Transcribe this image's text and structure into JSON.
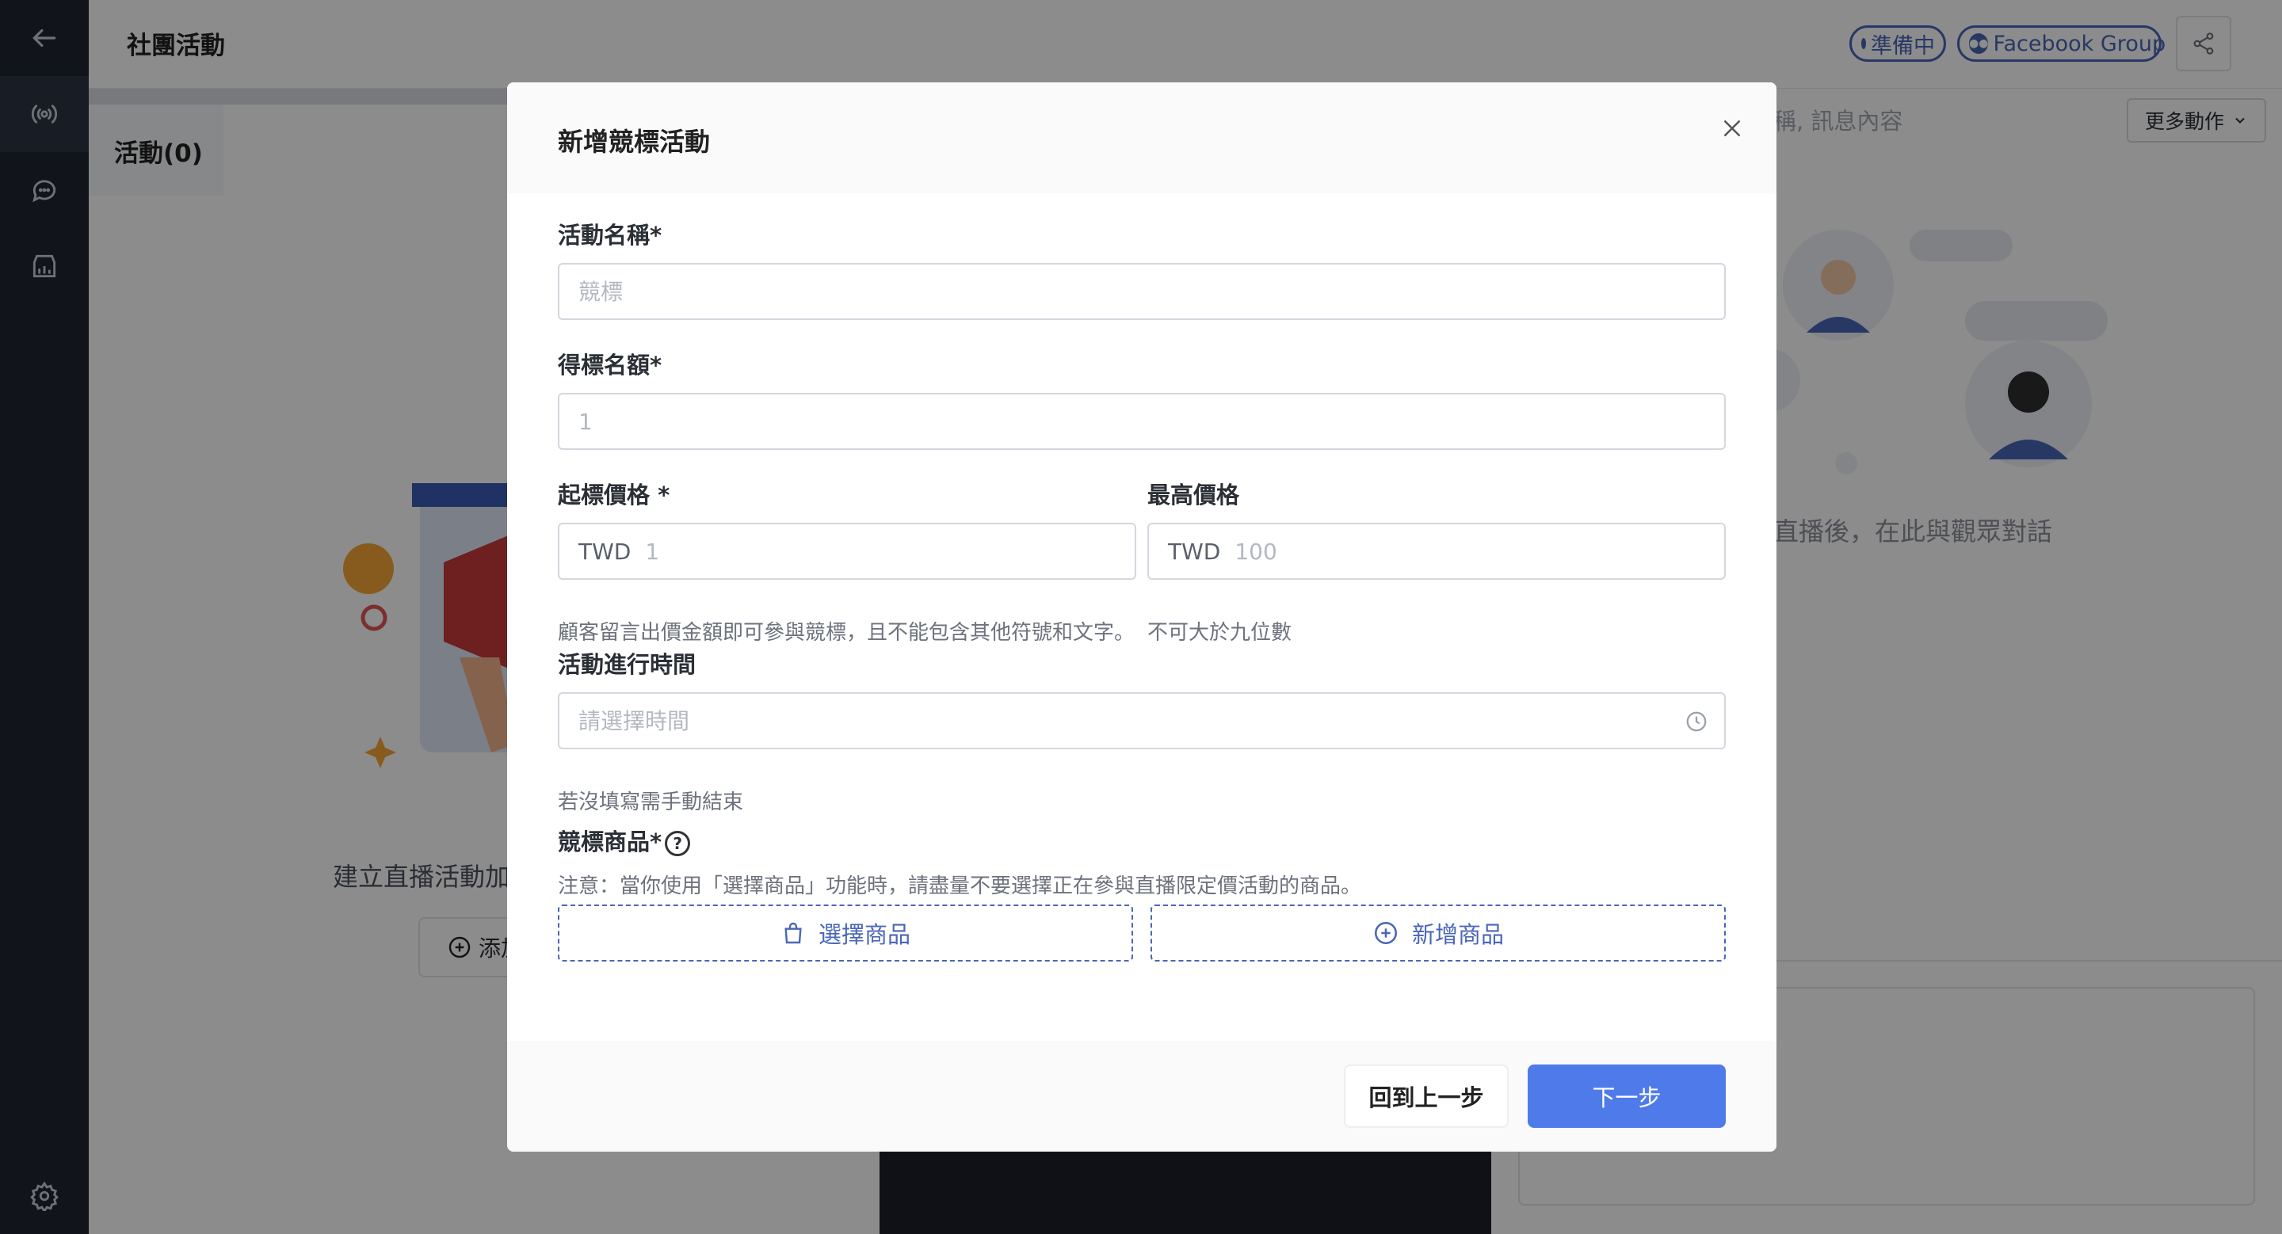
{
  "app": {
    "page_title": "社團活動",
    "status_badge": "準備中",
    "platform_badge": "Facebook Group",
    "more_actions": "更多動作",
    "search_placeholder_visible": "稱, 訊息內容",
    "tab_label": "活動(0)",
    "left_empty_message": "建立直播活動加",
    "add_button_label": "添加",
    "right_empty_message": "直播後，在此與觀眾對話"
  },
  "modal": {
    "title": "新增競標活動",
    "fields": {
      "activity_name": {
        "label": "活動名稱*",
        "placeholder": "競標"
      },
      "winner_count": {
        "label": "得標名額*",
        "placeholder": "1"
      },
      "start_price": {
        "label": "起標價格 *",
        "prefix": "TWD",
        "placeholder": "1",
        "hint": "顧客留言出價金額即可參與競標，且不能包含其他符號和文字。"
      },
      "max_price": {
        "label": "最高價格",
        "prefix": "TWD",
        "placeholder": "100",
        "hint": "不可大於九位數"
      },
      "duration": {
        "label": "活動進行時間",
        "placeholder": "請選擇時間",
        "hint": "若沒填寫需手動結束"
      },
      "products": {
        "label": "競標商品*",
        "note": "注意：當你使用「選擇商品」功能時，請盡量不要選擇正在參與直播限定價活動的商品。"
      }
    },
    "select_product": "選擇商品",
    "add_product": "新增商品",
    "back_button": "回到上一步",
    "next_button": "下一步"
  },
  "colors": {
    "primary": "#4f7bea",
    "accent_blue": "#4a66b8",
    "sidebar": "#1f2530"
  }
}
